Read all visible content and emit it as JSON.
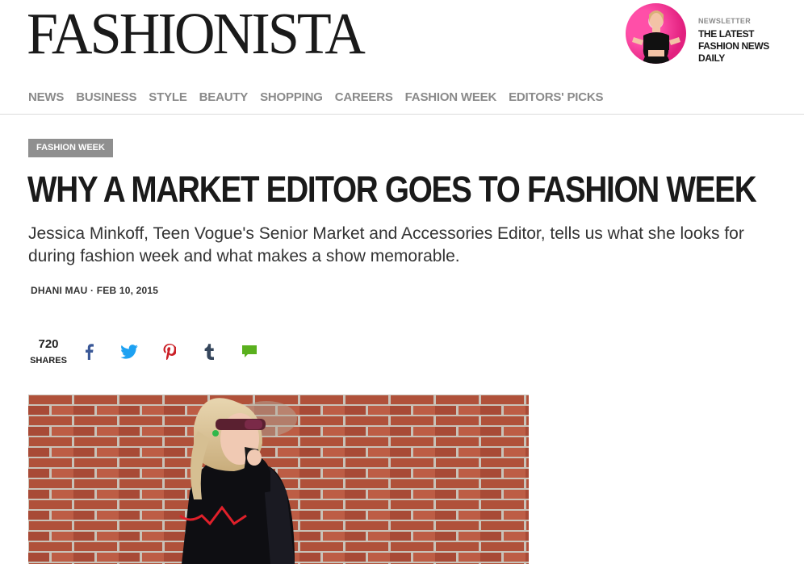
{
  "brand": {
    "logo": "FASHIONISTA"
  },
  "newsletter": {
    "kicker": "NEWSLETTER",
    "text": "THE LATEST FASHION NEWS DAILY"
  },
  "nav": {
    "items": [
      {
        "label": "NEWS"
      },
      {
        "label": "BUSINESS"
      },
      {
        "label": "STYLE"
      },
      {
        "label": "BEAUTY"
      },
      {
        "label": "SHOPPING"
      },
      {
        "label": "CAREERS"
      },
      {
        "label": "FASHION WEEK"
      },
      {
        "label": "EDITORS' PICKS"
      }
    ]
  },
  "article": {
    "category": "FASHION WEEK",
    "title": "WHY A MARKET EDITOR GOES TO FASHION WEEK",
    "dek": "Jessica Minkoff, Teen Vogue's Senior Market and Accessories Editor, tells us what she looks for during fashion week and what makes a show memorable.",
    "author": "DHANI MAU",
    "separator": " · ",
    "date": "FEB 10, 2015"
  },
  "share": {
    "count": "720",
    "label": "SHARES",
    "buttons": [
      {
        "icon": "facebook-icon",
        "color": "#3b5998"
      },
      {
        "icon": "twitter-icon",
        "color": "#1da1f2"
      },
      {
        "icon": "pinterest-icon",
        "color": "#cb2027"
      },
      {
        "icon": "tumblr-icon",
        "color": "#35465c"
      },
      {
        "icon": "comment-icon",
        "color": "#5ab01e"
      }
    ]
  },
  "colors": {
    "nav_text": "#8a8a8a",
    "tag_bg": "#8f8f8f",
    "brick": "#b4553e"
  }
}
